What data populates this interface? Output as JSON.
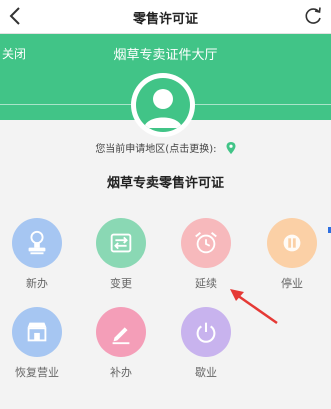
{
  "header": {
    "title": "零售许可证",
    "back_icon": "chevron-left-icon",
    "refresh_icon": "refresh-icon"
  },
  "banner": {
    "close_label": "关闭",
    "title": "烟草专卖证件大厅",
    "background_color": "#41c487"
  },
  "region": {
    "text": "您当前申请地区(点击更换):",
    "icon": "location-pin-icon"
  },
  "section_title": "烟草专卖零售许可证",
  "services": [
    {
      "label": "新办",
      "icon": "stamp-icon",
      "color": "#a6c6f2"
    },
    {
      "label": "变更",
      "icon": "exchange-icon",
      "color": "#8ad8b4"
    },
    {
      "label": "延续",
      "icon": "alarm-clock-icon",
      "color": "#f7b9bc"
    },
    {
      "label": "停业",
      "icon": "pause-icon",
      "color": "#fbd0a6"
    },
    {
      "label": "恢复营业",
      "icon": "store-icon",
      "color": "#a6c6f2"
    },
    {
      "label": "补办",
      "icon": "edit-icon",
      "color": "#f49eb8"
    },
    {
      "label": "歇业",
      "icon": "power-icon",
      "color": "#c8b3ee"
    }
  ],
  "annotation": {
    "arrow_color": "#e53935"
  }
}
